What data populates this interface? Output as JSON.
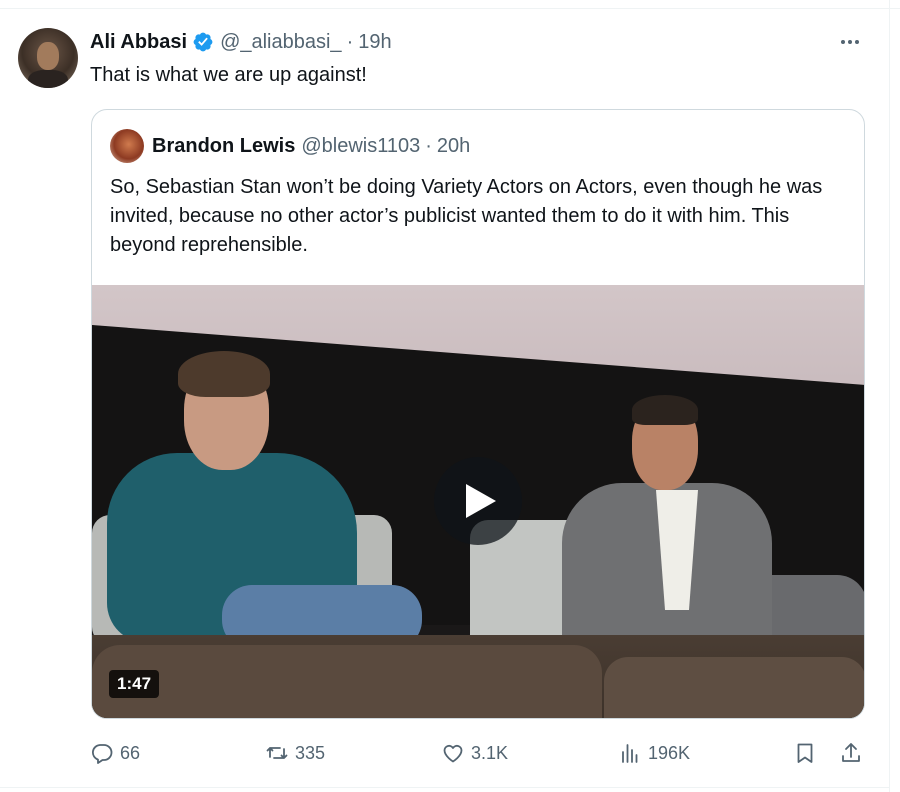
{
  "tweet": {
    "author": {
      "name": "Ali Abbasi",
      "handle": "@_aliabbasi_",
      "verified": true
    },
    "separator": "·",
    "time": "19h",
    "text": "That is what we are up against!",
    "more_icon": "ellipsis-icon"
  },
  "quoted_tweet": {
    "author": {
      "name": "Brandon Lewis",
      "handle": "@blewis1103"
    },
    "separator": "·",
    "time": "20h",
    "text": "So, Sebastian Stan won’t be doing Variety Actors on Actors, even though he was invited, because no other actor’s publicist wanted them to do it with him. This beyond reprehensible.",
    "media": {
      "type": "video",
      "duration": "1:47",
      "play_icon": "play-icon"
    }
  },
  "actions": {
    "replies": "66",
    "reposts": "335",
    "likes": "3.1K",
    "views": "196K"
  },
  "colors": {
    "text": "#0f1419",
    "secondary": "#536471",
    "verified": "#1d9bf0",
    "border": "#cfd9de"
  }
}
